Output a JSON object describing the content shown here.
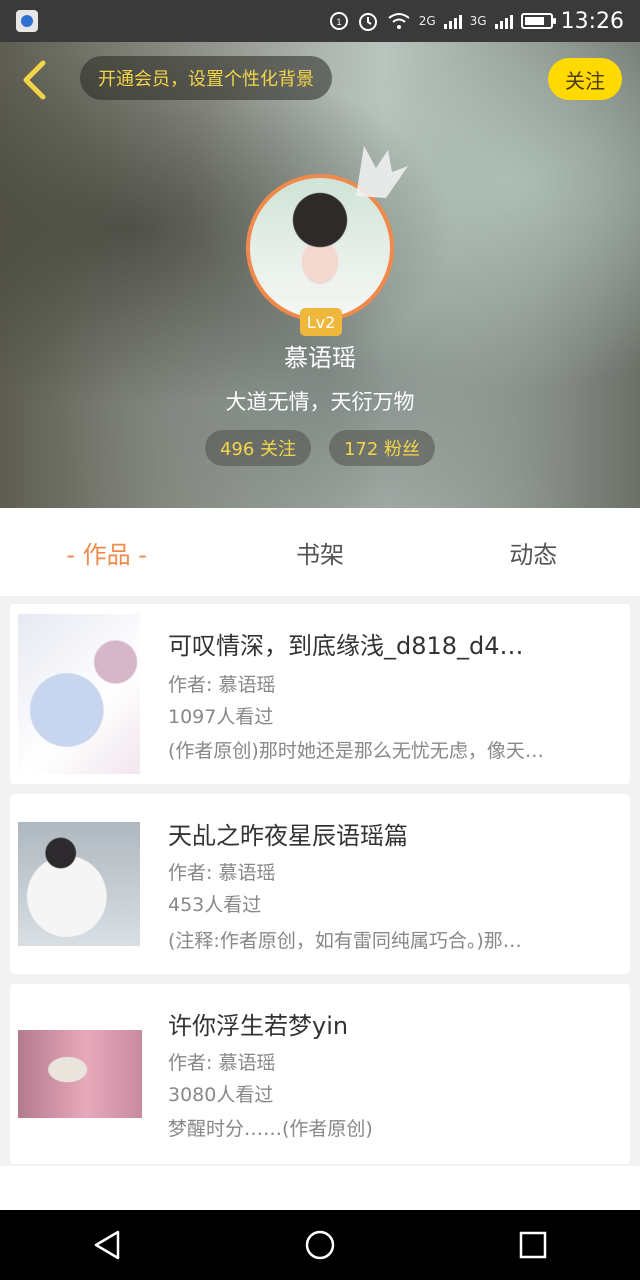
{
  "status_bar": {
    "time": "13:26",
    "net1": "2G",
    "net2": "3G",
    "battery_level": 0.8
  },
  "header": {
    "vip_banner": "开通会员，设置个性化背景",
    "follow_label": "关注",
    "level": "Lv2",
    "username": "慕语瑶",
    "bio": "大道无情，天衍万物",
    "following": "496 关注",
    "fans": "172 粉丝"
  },
  "tabs": [
    {
      "label": "- 作品 -",
      "active": true
    },
    {
      "label": "书架",
      "active": false
    },
    {
      "label": "动态",
      "active": false
    }
  ],
  "works": [
    {
      "title": "可叹情深，到底缘浅_d818_d4…",
      "author": "作者: 慕语瑶",
      "views": "1097人看过",
      "summary": "(作者原创)那时她还是那么无忧无虑，像天…"
    },
    {
      "title": "天乩之昨夜星辰语瑶篇",
      "author": "作者: 慕语瑶",
      "views": "453人看过",
      "summary": "(注释:作者原创，如有雷同纯属巧合。)那…"
    },
    {
      "title": "许你浮生若梦yin",
      "author": "作者: 慕语瑶",
      "views": "3080人看过",
      "summary": "梦醒时分……(作者原创)"
    }
  ],
  "colors": {
    "accent": "#f08a4b",
    "follow_button": "#ffd900",
    "gold_text": "#f4d54a",
    "level_badge": "#f0b73d"
  },
  "icons": [
    "app-icon",
    "alarm-icon",
    "wifi-icon",
    "signal-icon",
    "battery-icon",
    "back-icon",
    "crown-icon",
    "back-triangle-icon",
    "home-circle-icon",
    "recents-square-icon"
  ]
}
